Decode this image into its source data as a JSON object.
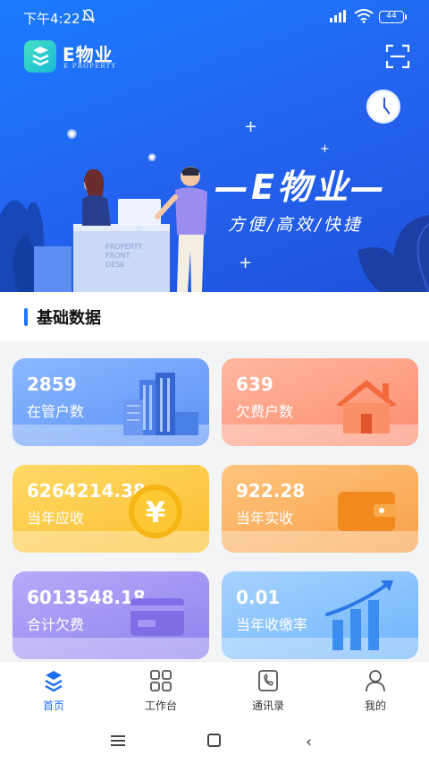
{
  "status_bar": {
    "time": "下午4:22",
    "battery": "44"
  },
  "brand": {
    "name": "E物业",
    "subtitle": "E PROPERTY"
  },
  "hero": {
    "title": "—E物业—",
    "subtitle": "方便/高效/快捷",
    "desk_sign": [
      "PROPERTY",
      "FRONT",
      "DESK"
    ]
  },
  "section": {
    "title": "基础数据"
  },
  "cards": [
    {
      "value": "2859",
      "label": "在管户数",
      "icon": "building-icon"
    },
    {
      "value": "639",
      "label": "欠费户数",
      "icon": "house-icon"
    },
    {
      "value": "6264214.38",
      "label": "当年应收",
      "icon": "yen-coin-icon"
    },
    {
      "value": "922.28",
      "label": "当年实收",
      "icon": "wallet-icon"
    },
    {
      "value": "6013548.18",
      "label": "合计欠费",
      "icon": "card-icon"
    },
    {
      "value": "0.01",
      "label": "当年收缴率",
      "icon": "rising-bars-icon"
    }
  ],
  "tabs": [
    {
      "label": "首页",
      "icon": "home-logo-icon",
      "active": true
    },
    {
      "label": "工作台",
      "icon": "grid-icon",
      "active": false
    },
    {
      "label": "通讯录",
      "icon": "phone-book-icon",
      "active": false
    },
    {
      "label": "我的",
      "icon": "person-icon",
      "active": false
    }
  ],
  "colors": {
    "primary": "#2176ff",
    "hero": "#1d63f0"
  }
}
